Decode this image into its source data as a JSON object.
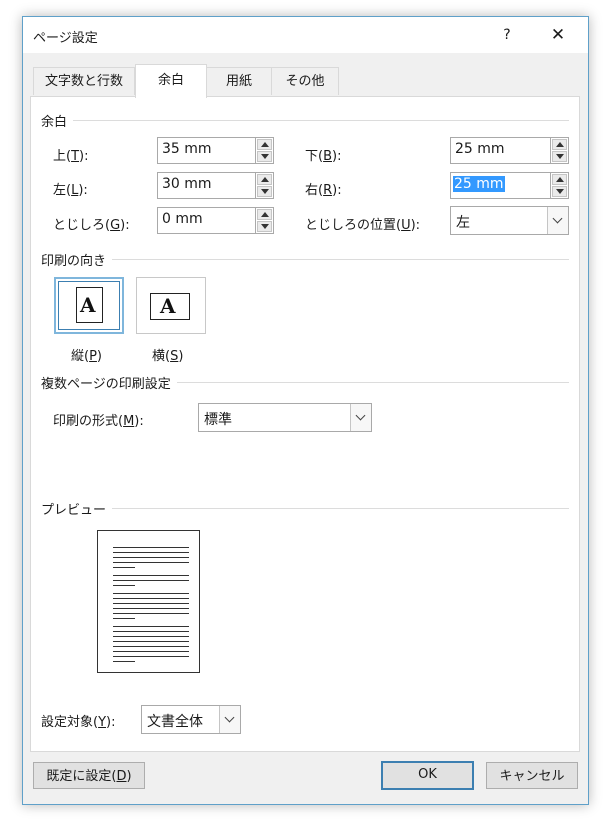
{
  "dialog": {
    "title": "ページ設定",
    "help_glyph": "?",
    "close_glyph": "✕"
  },
  "tabs": [
    {
      "label": "文字数と行数",
      "active": false
    },
    {
      "label": "余白",
      "active": true
    },
    {
      "label": "用紙",
      "active": false
    },
    {
      "label": "その他",
      "active": false
    }
  ],
  "margins": {
    "section_label": "余白",
    "top": {
      "label_pre": "上(",
      "key": "T",
      "label_post": "):",
      "value": "35 mm"
    },
    "bottom": {
      "label_pre": "下(",
      "key": "B",
      "label_post": "):",
      "value": "25 mm"
    },
    "left": {
      "label_pre": "左(",
      "key": "L",
      "label_post": "):",
      "value": "30 mm"
    },
    "right": {
      "label_pre": "右(",
      "key": "R",
      "label_post": "):",
      "value": "25 mm"
    },
    "gutter": {
      "label_pre": "とじしろ(",
      "key": "G",
      "label_post": "):",
      "value": "0 mm"
    },
    "gutter_position": {
      "label_pre": "とじしろの位置(",
      "key": "U",
      "label_post": "):",
      "value": "左"
    }
  },
  "orientation": {
    "section_label": "印刷の向き",
    "portrait": {
      "label_pre": "縦(",
      "key": "P",
      "label_post": ")",
      "glyph": "A",
      "selected": true
    },
    "landscape": {
      "label_pre": "横(",
      "key": "S",
      "label_post": ")",
      "glyph": "A",
      "selected": false
    }
  },
  "pages": {
    "section_label": "複数ページの印刷設定",
    "label_pre": "印刷の形式(",
    "key": "M",
    "label_post": "):",
    "value": "標準"
  },
  "preview": {
    "section_label": "プレビュー"
  },
  "apply_to": {
    "label_pre": "設定対象(",
    "key": "Y",
    "label_post": "):",
    "value": "文書全体"
  },
  "footer": {
    "default_pre": "既定に設定(",
    "default_key": "D",
    "default_post": ")",
    "ok": "OK",
    "cancel": "キャンセル"
  },
  "colors": {
    "accent": "#3c7fb1",
    "selection": "#3399ff",
    "window_border": "#5fa0c9"
  }
}
